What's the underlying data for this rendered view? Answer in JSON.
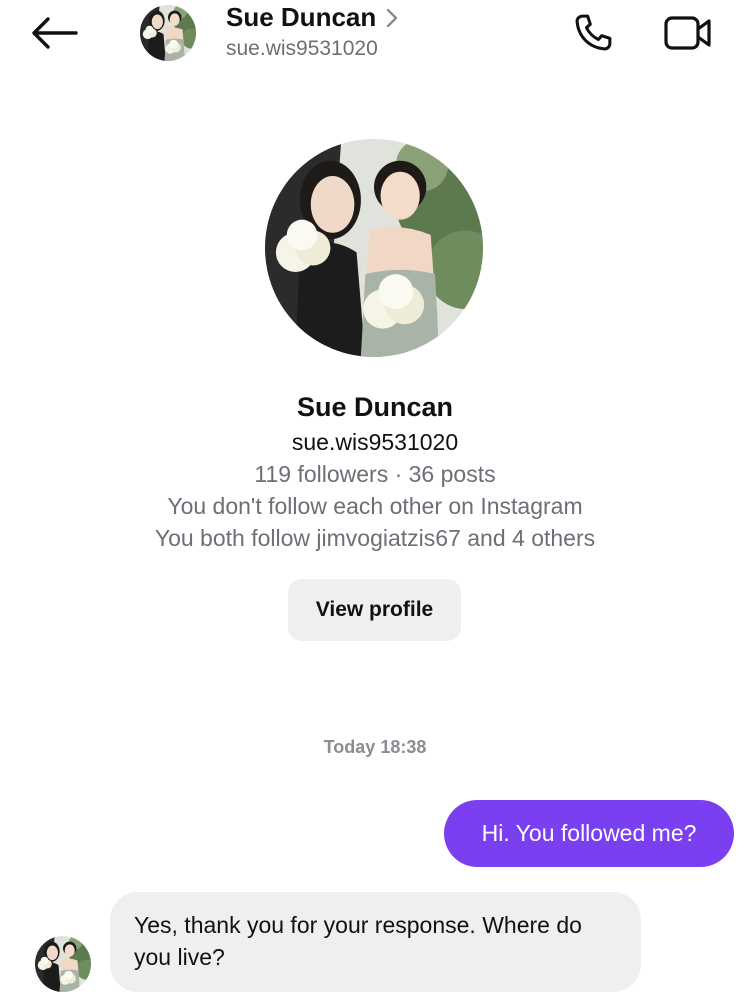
{
  "header": {
    "title": "Sue Duncan",
    "username": "sue.wis9531020",
    "icons": {
      "back": "back-arrow-icon",
      "chevron": "chevron-right-icon",
      "call": "phone-icon",
      "video": "video-camera-icon"
    }
  },
  "profile": {
    "name": "Sue Duncan",
    "username": "sue.wis9531020",
    "stats": "119 followers · 36 posts",
    "follow_status": "You don't follow each other on Instagram",
    "mutuals": "You both follow jimvogiatzis67 and 4 others",
    "view_profile_label": "View profile"
  },
  "chat": {
    "timestamp": "Today 18:38",
    "messages": [
      {
        "direction": "outgoing",
        "text": "Hi. You followed me?"
      },
      {
        "direction": "incoming",
        "text": "Yes, thank you for your response. Where do you live?"
      }
    ]
  },
  "colors": {
    "accent": "#7b3ff2",
    "incoming_bubble": "#efefef",
    "secondary_text": "#6b6f76"
  }
}
